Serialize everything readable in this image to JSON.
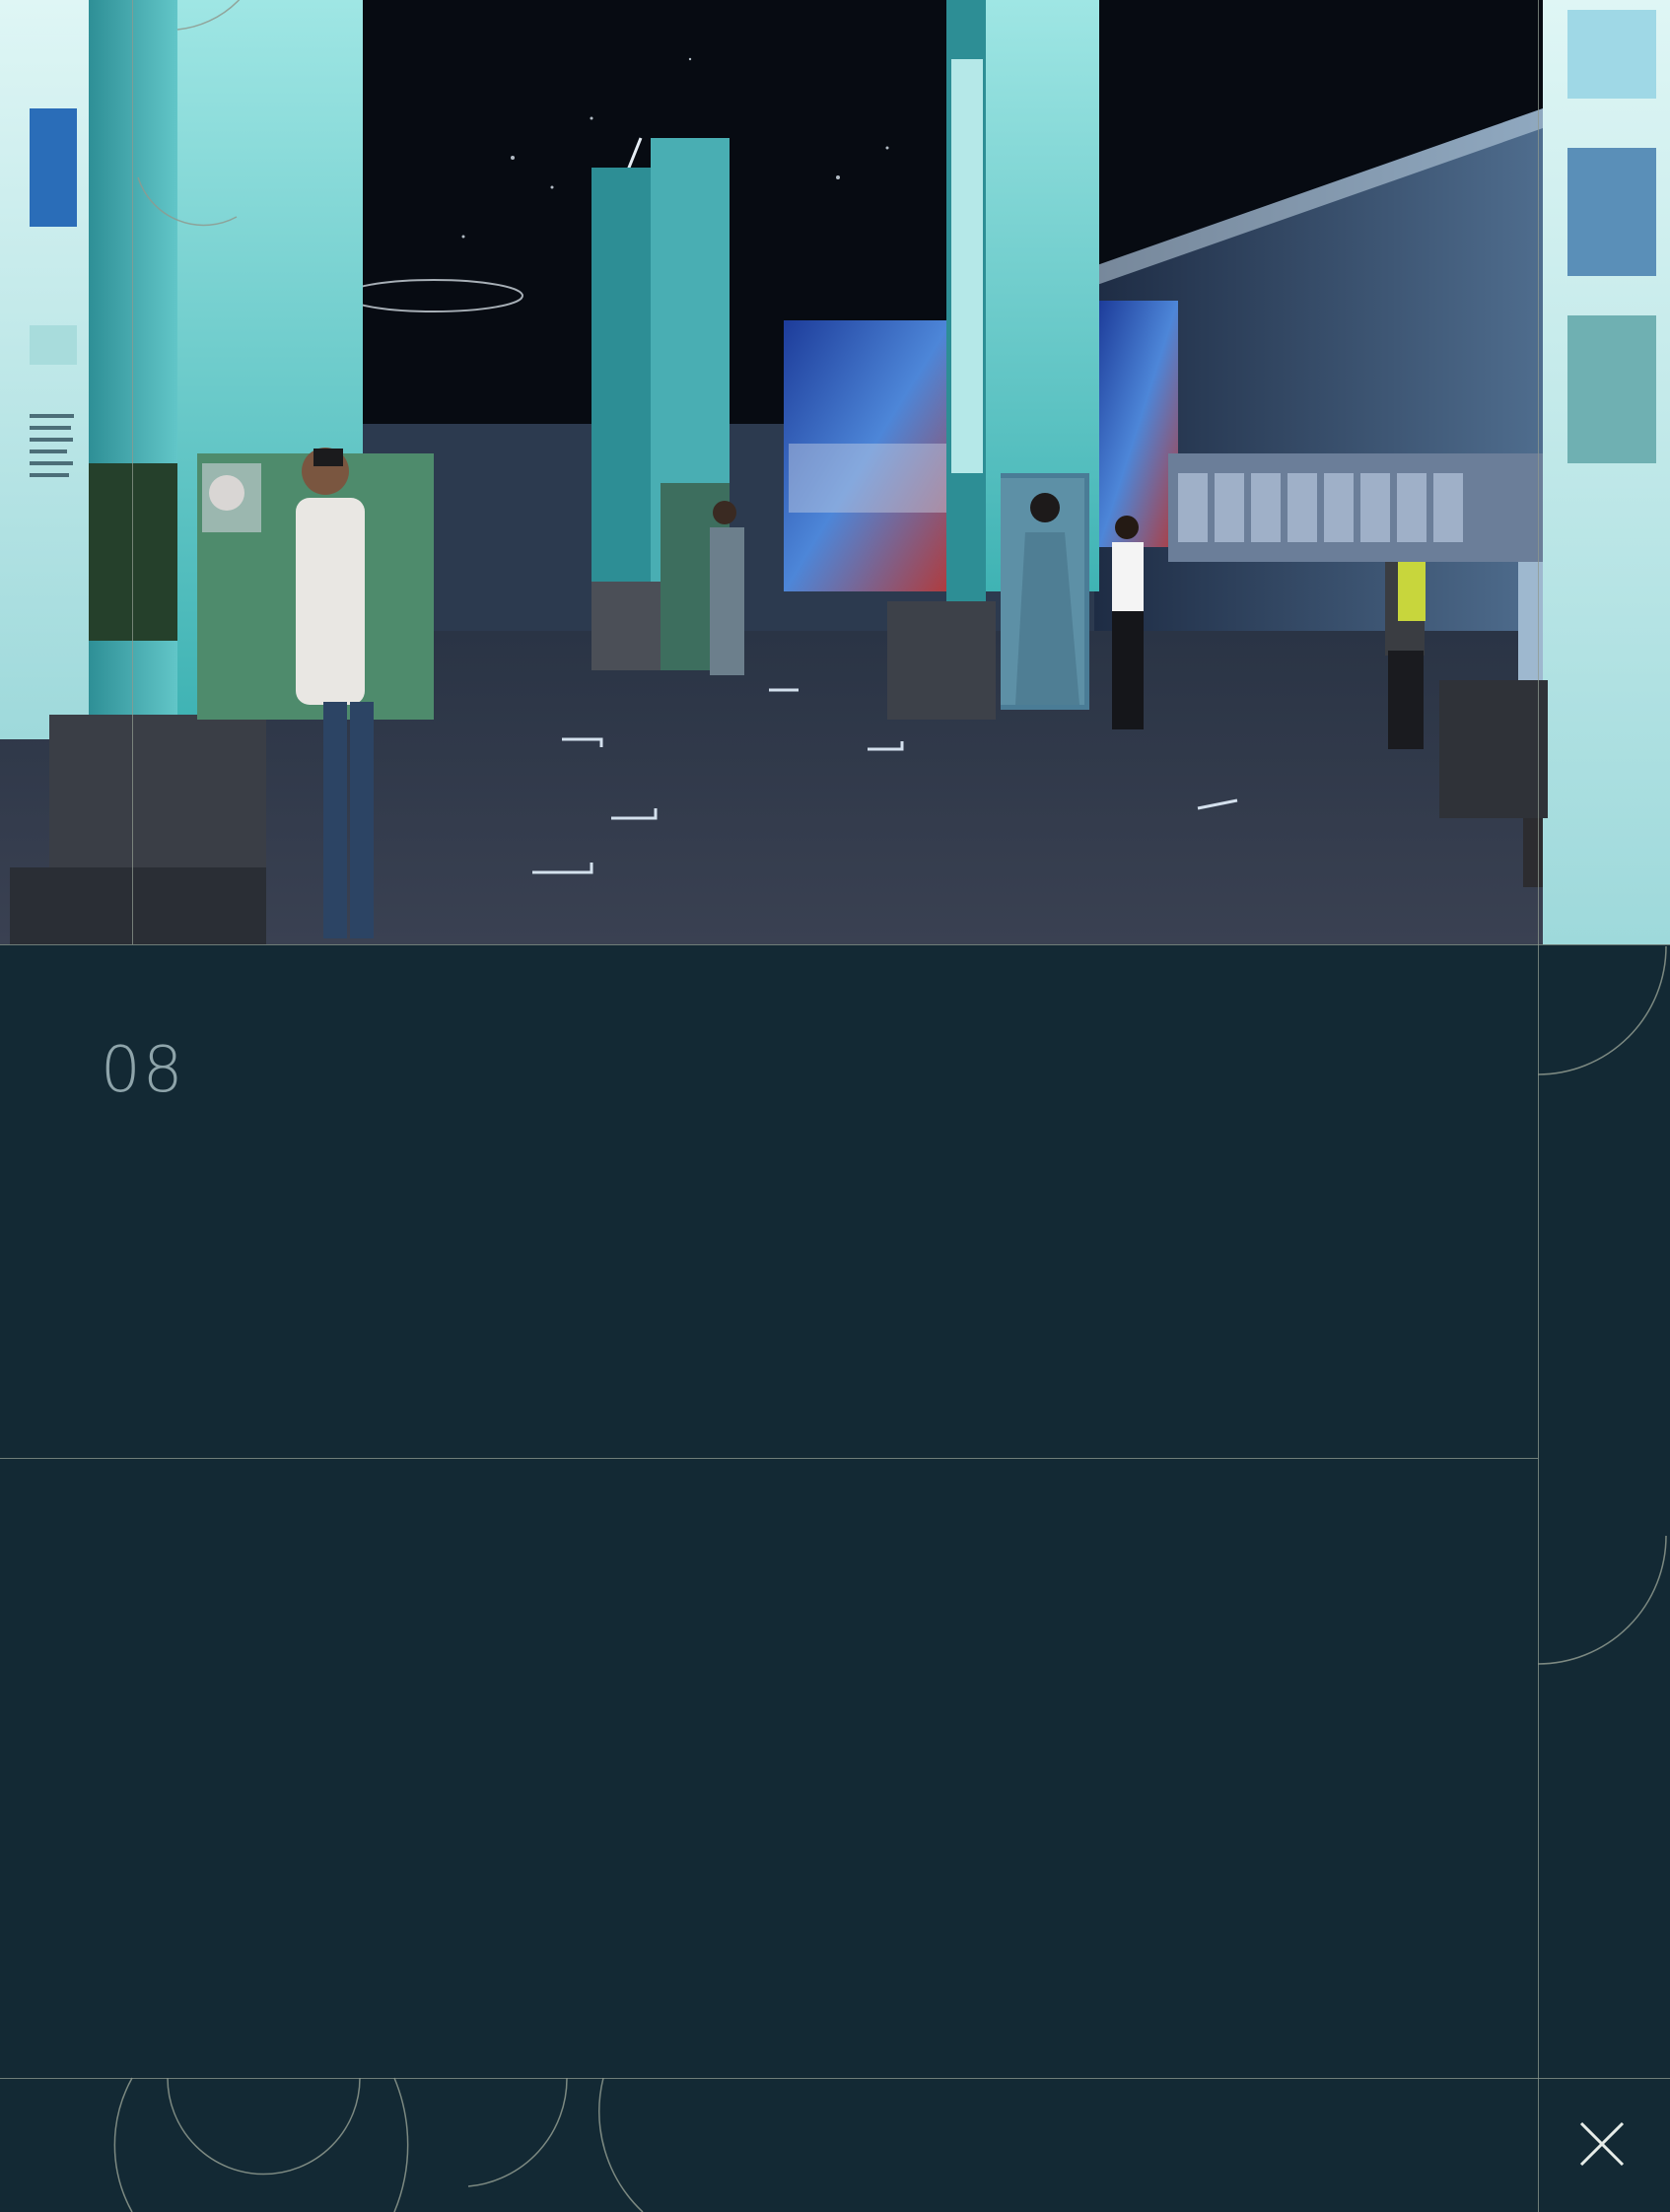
{
  "slide": {
    "number": "08"
  },
  "hero": {
    "kind": "photo",
    "subject": "museum-hall"
  },
  "colors": {
    "background": "#132934",
    "frame_line": "#8f9a8f",
    "accent_teal": "#5fd3d0",
    "number_text": "#8ea4aa"
  },
  "controls": {
    "close_icon": "close-icon"
  }
}
